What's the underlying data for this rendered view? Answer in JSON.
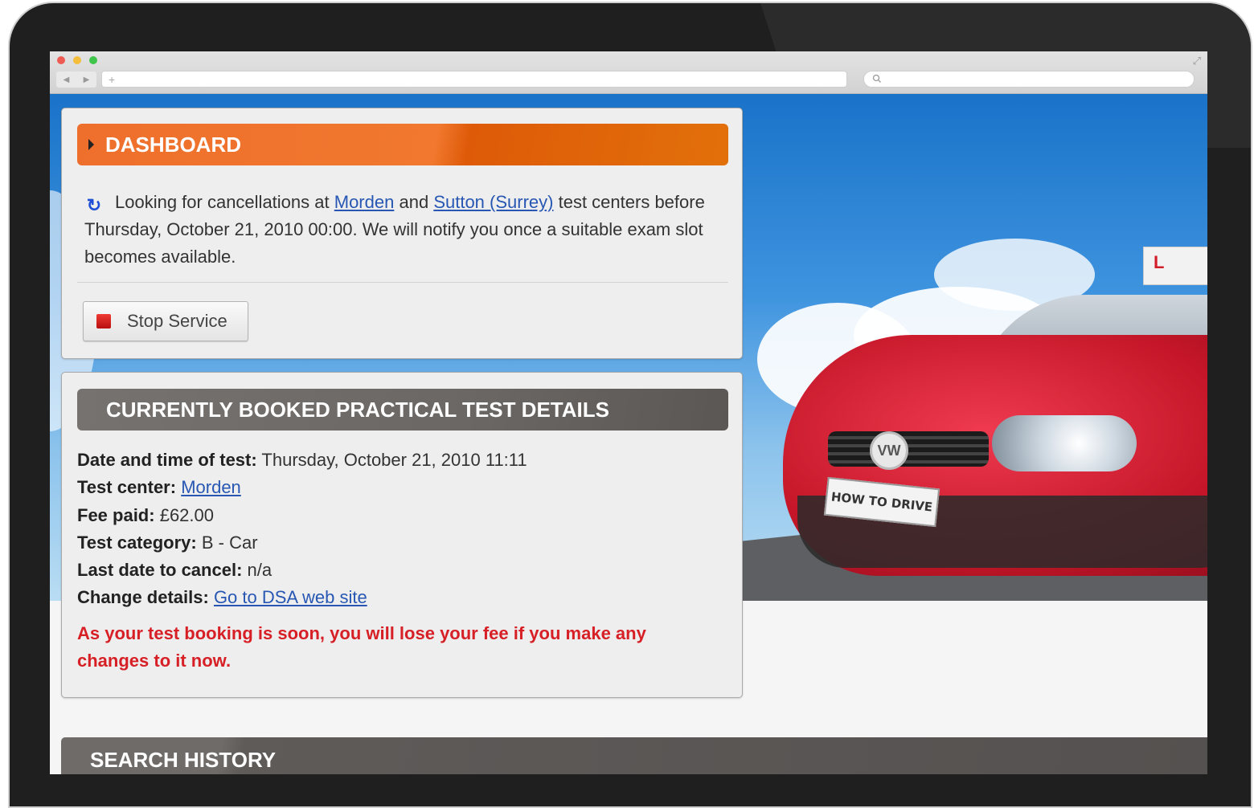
{
  "browser": {
    "nav_back": "◀",
    "nav_forward": "▶",
    "new_tab": "+",
    "search_icon": "search-icon"
  },
  "hero": {
    "plate_text": "HOW TO DRIVE",
    "sign_text": "L",
    "car_logo": "VW"
  },
  "dashboard": {
    "title": "DASHBOARD",
    "status": {
      "prefix": "Looking for cancellations at",
      "center_1": "Morden",
      "connector": "and",
      "center_2": "Sutton (Surrey)",
      "suffix": "test centers before Thursday, October 21, 2010 00:00. We will notify you once a suitable exam slot becomes available."
    },
    "stop_button": "Stop Service"
  },
  "booked": {
    "title": "CURRENTLY BOOKED PRACTICAL TEST DETAILS",
    "rows": [
      {
        "label": "Date and time of test:",
        "value": "Thursday, October 21, 2010 11:11"
      },
      {
        "label": "Test center:",
        "value": "Morden"
      },
      {
        "label": "Fee paid:",
        "value": "£62.00"
      },
      {
        "label": "Test category:",
        "value": "B - Car"
      },
      {
        "label": "Last date to cancel:",
        "value": "n/a"
      },
      {
        "label": "Change details:",
        "value": "Go to DSA web site"
      }
    ],
    "warning": "As your test booking is soon, you will lose your fee if you make any changes to it now."
  },
  "search_history": {
    "title": "SEARCH HISTORY"
  },
  "colors": {
    "accent_orange": "#ee6f2c",
    "header_grey": "#6b6765",
    "warning_red": "#d71f26",
    "link_blue": "#2757b3"
  }
}
